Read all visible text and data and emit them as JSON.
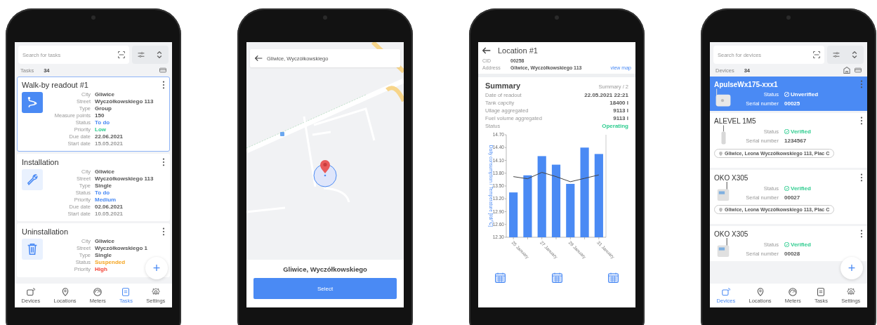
{
  "tasks_screen": {
    "search": {
      "placeholder": "Search for tasks"
    },
    "count_label": "Tasks",
    "count": "34",
    "tasks": [
      {
        "title": "Walk-by readout #1",
        "kind": "group",
        "selected": true,
        "fields": [
          {
            "label": "City",
            "value": "Gliwice",
            "color": "#555555"
          },
          {
            "label": "Street",
            "value": "Wyczółkowskiego 113",
            "color": "#555555"
          },
          {
            "label": "Type",
            "value": "Group",
            "color": "#555555"
          },
          {
            "label": "Measure points",
            "value": "150",
            "color": "#555555"
          },
          {
            "label": "Status",
            "value": "To do",
            "color": "#4a8af4"
          },
          {
            "label": "Priority",
            "value": "Low",
            "color": "#2ecc8f"
          },
          {
            "label": "Due date",
            "value": "22.06.2021",
            "color": "#555555"
          },
          {
            "label": "Start date",
            "value": "15.05.2021",
            "color": "#999999"
          }
        ]
      },
      {
        "title": "Installation",
        "kind": "install",
        "selected": false,
        "fields": [
          {
            "label": "City",
            "value": "Gliwice",
            "color": "#555555"
          },
          {
            "label": "Street",
            "value": "Wyczółkowskiego 113",
            "color": "#555555"
          },
          {
            "label": "Type",
            "value": "Single",
            "color": "#555555"
          },
          {
            "label": "Status",
            "value": "To do",
            "color": "#4a8af4"
          },
          {
            "label": "Priority",
            "value": "Medium",
            "color": "#4a8af4"
          },
          {
            "label": "Due date",
            "value": "02.06.2021",
            "color": "#555555"
          },
          {
            "label": "Start date",
            "value": "10.05.2021",
            "color": "#999999"
          }
        ]
      },
      {
        "title": "Uninstallation",
        "kind": "uninstall",
        "selected": false,
        "fields": [
          {
            "label": "City",
            "value": "Gliwice",
            "color": "#555555"
          },
          {
            "label": "Street",
            "value": "Wyczółkowskiego 1",
            "color": "#555555"
          },
          {
            "label": "Type",
            "value": "Single",
            "color": "#555555"
          },
          {
            "label": "Status",
            "value": "Suspended",
            "color": "#f5a623"
          },
          {
            "label": "Priority",
            "value": "High",
            "color": "#f44336"
          }
        ]
      }
    ],
    "fab": "+",
    "nav": [
      {
        "label": "Devices",
        "selected": false
      },
      {
        "label": "Locations",
        "selected": false
      },
      {
        "label": "Meters",
        "selected": false
      },
      {
        "label": "Tasks",
        "selected": true
      },
      {
        "label": "Settings",
        "selected": false
      }
    ]
  },
  "map_screen": {
    "search": {
      "value": "Gliwice, Wyczółkowskiego"
    },
    "place_title": "Gliwice, Wyczółkowskiego",
    "button": "Select"
  },
  "location_screen": {
    "title": "Location #1",
    "info": [
      {
        "label": "CID",
        "value": "00258"
      },
      {
        "label": "Address",
        "value": "Gliwice, Wyczółkowskiego 113"
      }
    ],
    "link": "view map",
    "summary": {
      "title": "Summary",
      "page": "Summary / 2",
      "rows": [
        {
          "label": "Date of readout",
          "value": "22.05.2021 22:21",
          "color": "#555555"
        },
        {
          "label": "Tank capcity",
          "value": "18400 l",
          "color": "#555555"
        },
        {
          "label": "Ullage aggregated",
          "value": "9113 l",
          "color": "#555555"
        },
        {
          "label": "Fuel volume aggregated",
          "value": "9113 l",
          "color": "#555555"
        },
        {
          "label": "Status",
          "value": "Operating",
          "color": "#2ecc8f"
        }
      ]
    },
    "chart_data": {
      "type": "bar",
      "ylabel": "Daily consumption / Temperature [l/d/°C]",
      "categories": [
        "25 January",
        null,
        "27 January",
        null,
        "29 January",
        null,
        "31 January"
      ],
      "ylim": [
        12.3,
        14.7
      ],
      "yticks": [
        {
          "value": 12.3,
          "label": "12.30"
        },
        {
          "value": 12.6,
          "label": "12.60"
        },
        {
          "value": 12.9,
          "label": "12.90"
        },
        {
          "value": 13.2,
          "label": "13.20"
        },
        {
          "value": 13.5,
          "label": "13.50"
        },
        {
          "value": 13.8,
          "label": "13.80"
        },
        {
          "value": 14.1,
          "label": "14.10"
        },
        {
          "value": 14.4,
          "label": "14.40"
        },
        {
          "value": 14.7,
          "label": "14.70"
        }
      ],
      "series": [
        {
          "color": "#4a8af4",
          "values": [
            13.35,
            13.75,
            14.2,
            14.0,
            13.55,
            14.4,
            14.25
          ]
        },
        {
          "type": "line",
          "color": "#444444",
          "values": [
            13.72,
            13.67,
            13.82,
            13.72,
            13.6,
            13.68,
            13.76
          ]
        }
      ]
    }
  },
  "devices_screen": {
    "search": {
      "placeholder": "Search for devices"
    },
    "count_label": "Devices",
    "count": "34",
    "devices": [
      {
        "name": "ApulseWx175-xxx1",
        "kind": "gateway",
        "selected": true,
        "fields": [
          {
            "label": "Status",
            "value": "Unverified",
            "verified": false
          },
          {
            "label": "Serial number",
            "value": "00025"
          }
        ]
      },
      {
        "name": "ALEVEL 1M5",
        "kind": "probe",
        "selected": false,
        "fields": [
          {
            "label": "Status",
            "value": "Verified",
            "verified": true
          },
          {
            "label": "Serial number",
            "value": "1234567"
          }
        ],
        "address": "Gliwice, Leona Wyczółkowskiego 113, Plac C"
      },
      {
        "name": "OKO X305",
        "kind": "meter",
        "selected": false,
        "fields": [
          {
            "label": "Status",
            "value": "Verified",
            "verified": true
          },
          {
            "label": "Serial number",
            "value": "00027"
          }
        ],
        "address": "Gliwice, Leona Wyczółkowskiego 113, Plac C"
      },
      {
        "name": "OKO X305",
        "kind": "meter",
        "selected": false,
        "fields": [
          {
            "label": "Status",
            "value": "Verified",
            "verified": true
          },
          {
            "label": "Serial number",
            "value": "00028"
          }
        ]
      }
    ],
    "fab": "+",
    "nav": [
      {
        "label": "Devices",
        "selected": true
      },
      {
        "label": "Locations",
        "selected": false
      },
      {
        "label": "Meters",
        "selected": false
      },
      {
        "label": "Tasks",
        "selected": false
      },
      {
        "label": "Settings",
        "selected": false
      }
    ]
  }
}
